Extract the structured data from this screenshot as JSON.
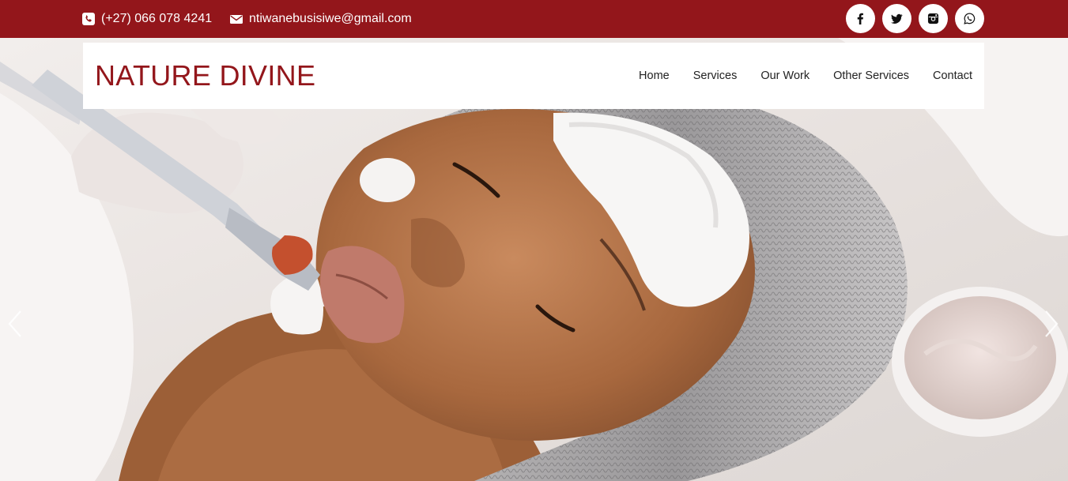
{
  "topbar": {
    "phone": {
      "icon": "phone-icon",
      "text": "(+27) 066 078 4241"
    },
    "email": {
      "icon": "envelope-icon",
      "text": "ntiwanebusisiwe@gmail.com"
    },
    "social": [
      {
        "icon": "facebook-icon"
      },
      {
        "icon": "twitter-icon"
      },
      {
        "icon": "instagram-icon"
      },
      {
        "icon": "whatsapp-icon"
      }
    ],
    "colors": {
      "background": "#93161b",
      "text": "#ffffff"
    }
  },
  "navbar": {
    "brand": "NATURE DIVINE",
    "menu": [
      "Home",
      "Services",
      "Our Work",
      "Other Services",
      "Contact"
    ],
    "colors": {
      "brand": "#93161b",
      "menu_text": "#222222"
    }
  },
  "hero": {
    "image": "facial-treatment-photo",
    "prev_icon": "chevron-left-icon",
    "next_icon": "chevron-right-icon"
  }
}
